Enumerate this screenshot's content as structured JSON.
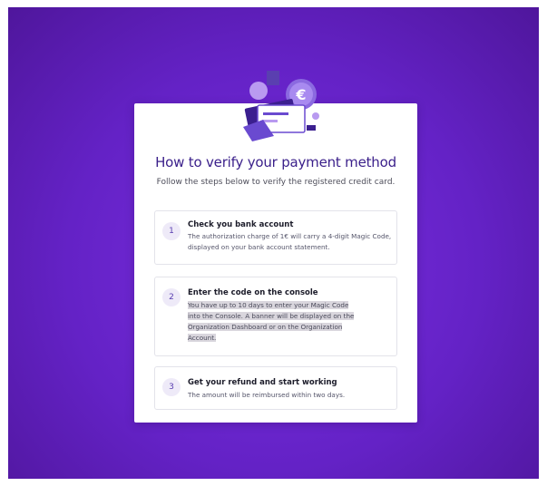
{
  "dialog": {
    "title": "How to verify your payment method",
    "subtitle": "Follow the steps below to verify the registered credit card.",
    "illustration_icon": "credit-card-euro-icon"
  },
  "steps": [
    {
      "number": "1",
      "title": "Check you bank account",
      "description": "The authorization charge of 1€ will carry a 4-digit Magic Code, displayed on your bank account statement."
    },
    {
      "number": "2",
      "title": "Enter the code on the console",
      "description": "You have up to 10 days to enter your Magic Code into the Console. A banner will be displayed on the Organization Dashboard or on the Organization Account."
    },
    {
      "number": "3",
      "title": "Get your refund and start working",
      "description": "The amount will be reimbursed within two days."
    }
  ],
  "colors": {
    "background": "#6422c6",
    "accent": "#5a3fb0",
    "title": "#3a1f8a"
  }
}
